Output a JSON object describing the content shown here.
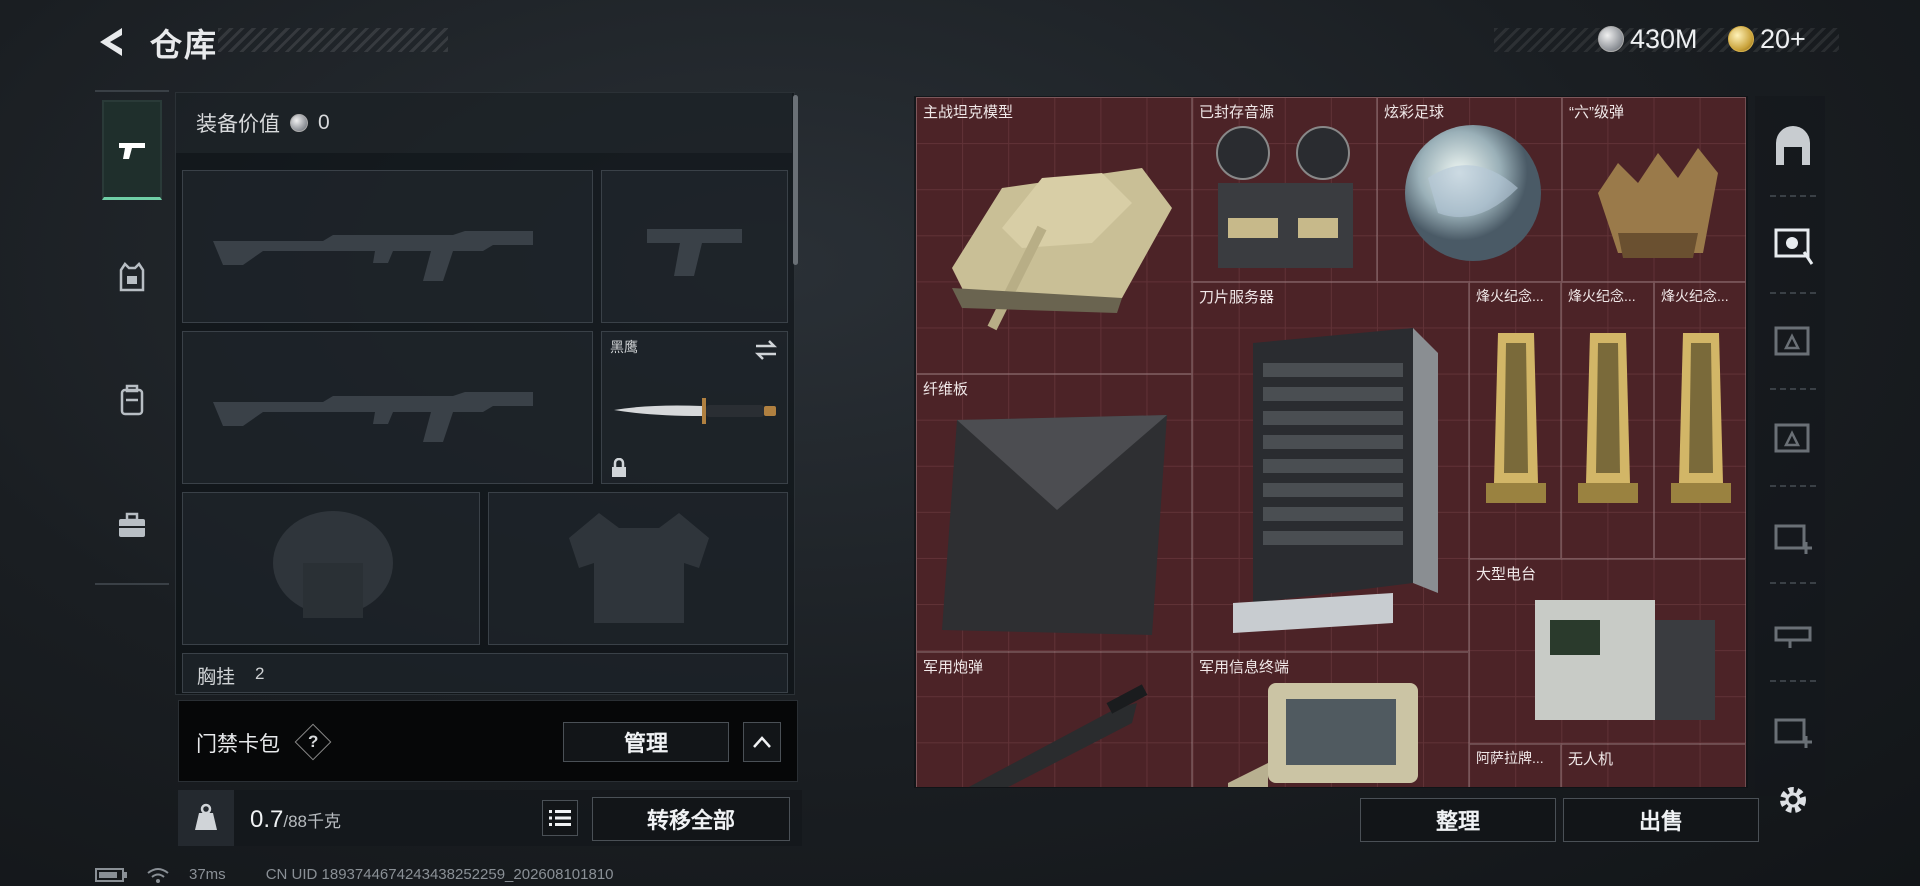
{
  "header": {
    "title": "仓库",
    "back_icon": "back-arrow-icon"
  },
  "currency": {
    "silver": "430M",
    "gold": "20+"
  },
  "left_nav": {
    "items": [
      {
        "id": "weapons",
        "icon": "pistol-icon",
        "active": true
      },
      {
        "id": "armor",
        "icon": "vest-icon",
        "active": false
      },
      {
        "id": "backpack",
        "icon": "backpack-icon",
        "active": false
      },
      {
        "id": "kit",
        "icon": "toolbox-icon",
        "active": false
      }
    ]
  },
  "equipment": {
    "value_label": "装备价值",
    "value": "0",
    "melee_name": "黑鹰",
    "chest_label": "胸挂",
    "chest_count": "2"
  },
  "card_pack": {
    "label": "门禁卡包",
    "help": "?",
    "manage_label": "管理"
  },
  "weight": {
    "current": "0.7",
    "max": "/88千克",
    "unit_icon": "kg-icon"
  },
  "actions": {
    "transfer_all": "转移全部",
    "organize": "整理",
    "sell": "出售"
  },
  "stash_items": [
    {
      "name": "主战坦克模型",
      "icon": "tank-icon"
    },
    {
      "name": "已封存音源",
      "icon": "reel-recorder-icon"
    },
    {
      "name": "炫彩足球",
      "icon": "ball-icon"
    },
    {
      "name": "“六”级弹",
      "icon": "bullets-icon"
    },
    {
      "name": "刀片服务器",
      "icon": "server-icon"
    },
    {
      "name": "烽火纪念...",
      "icon": "trophy-icon"
    },
    {
      "name": "烽火纪念...",
      "icon": "trophy-icon"
    },
    {
      "name": "烽火纪念...",
      "icon": "trophy-icon"
    },
    {
      "name": "纤维板",
      "icon": "carbon-plate-icon"
    },
    {
      "name": "大型电台",
      "icon": "radio-icon"
    },
    {
      "name": "军用炮弹",
      "icon": "shell-icon"
    },
    {
      "name": "军用信息终端",
      "icon": "terminal-icon"
    },
    {
      "name": "阿萨拉牌...",
      "icon": "plaque-icon"
    },
    {
      "name": "无人机",
      "icon": "drone-icon"
    }
  ],
  "status": {
    "ping": "37ms",
    "uid": "CN UID 1893744674243438252259_202608101810"
  },
  "colors": {
    "accent": "#6fcfa6",
    "grid_bg": "#4a2326"
  }
}
